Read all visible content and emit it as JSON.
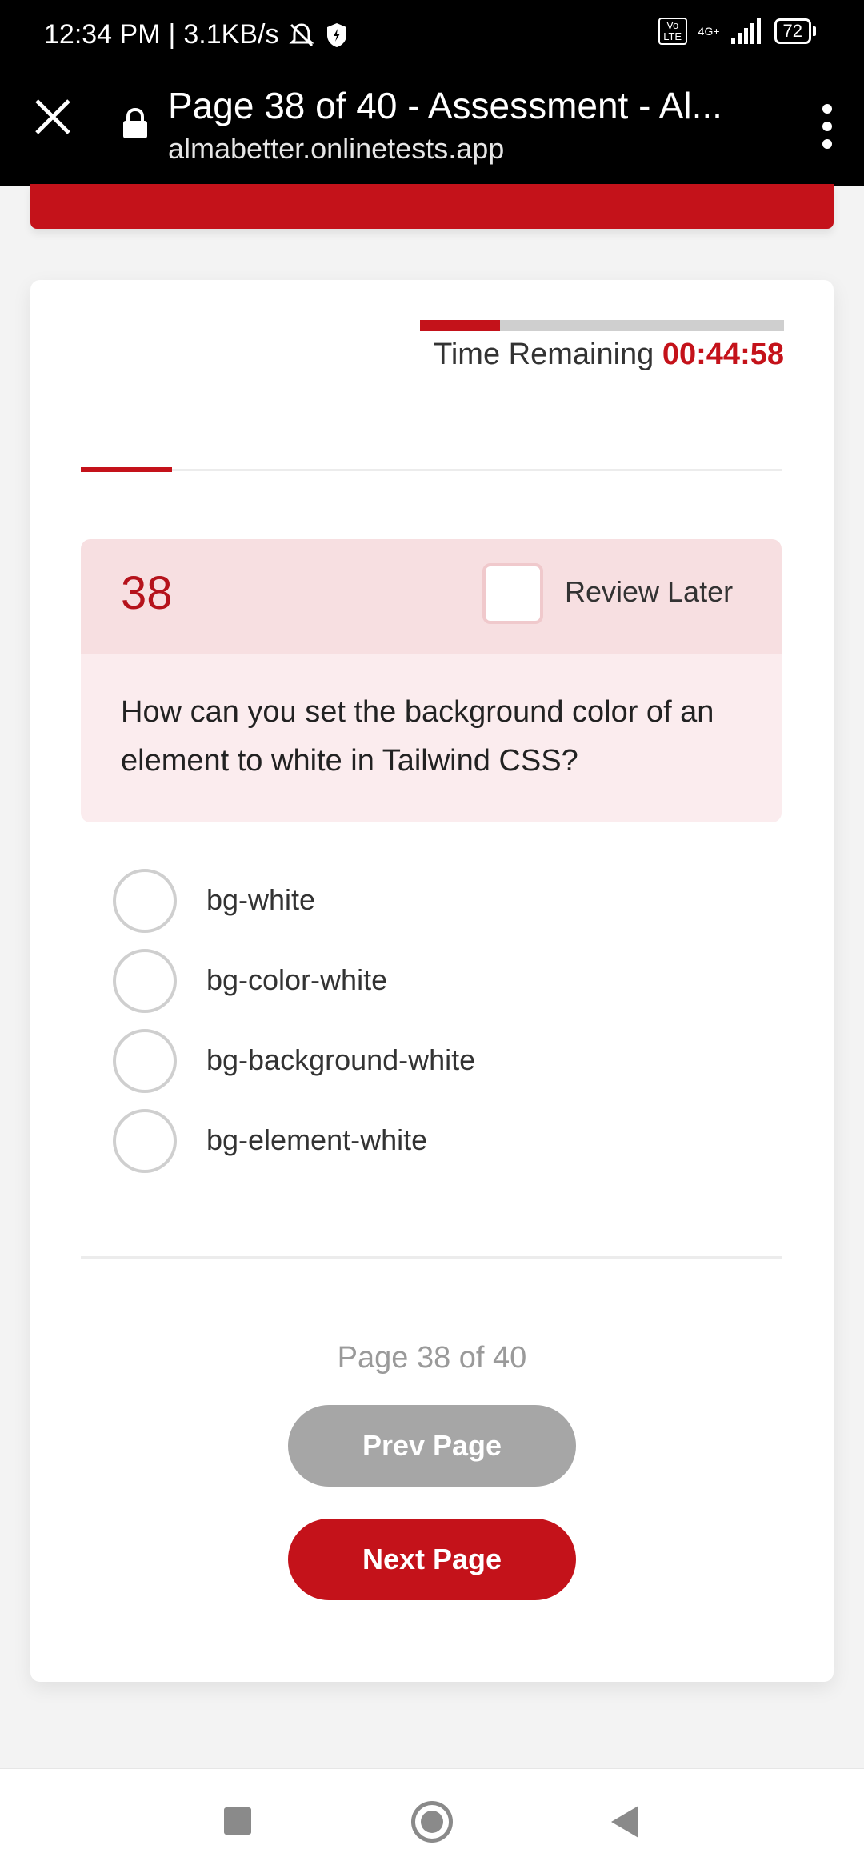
{
  "status_bar": {
    "time": "12:34 PM",
    "net_speed": "3.1KB/s",
    "network": "4G+",
    "volte": "Vo LTE",
    "battery": "72"
  },
  "browser": {
    "title": "Page 38 of 40 - Assessment - Al...",
    "url": "almabetter.onlinetests.app"
  },
  "timer": {
    "label": "Time Remaining",
    "value": "00:44:58",
    "progress_fraction": 0.22
  },
  "question": {
    "number": "38",
    "review_label": "Review Later",
    "text": "How can you set the background color of an element to white in Tailwind CSS?",
    "options": [
      {
        "label": "bg-white"
      },
      {
        "label": "bg-color-white"
      },
      {
        "label": "bg-background-white"
      },
      {
        "label": "bg-element-white"
      }
    ]
  },
  "pagination": {
    "indicator": "Page 38 of 40",
    "prev_label": "Prev Page",
    "next_label": "Next Page"
  },
  "colors": {
    "accent": "#c4121a",
    "header_bg": "#f7dfe1",
    "body_bg": "#fbecee",
    "disabled": "#a6a6a6"
  }
}
